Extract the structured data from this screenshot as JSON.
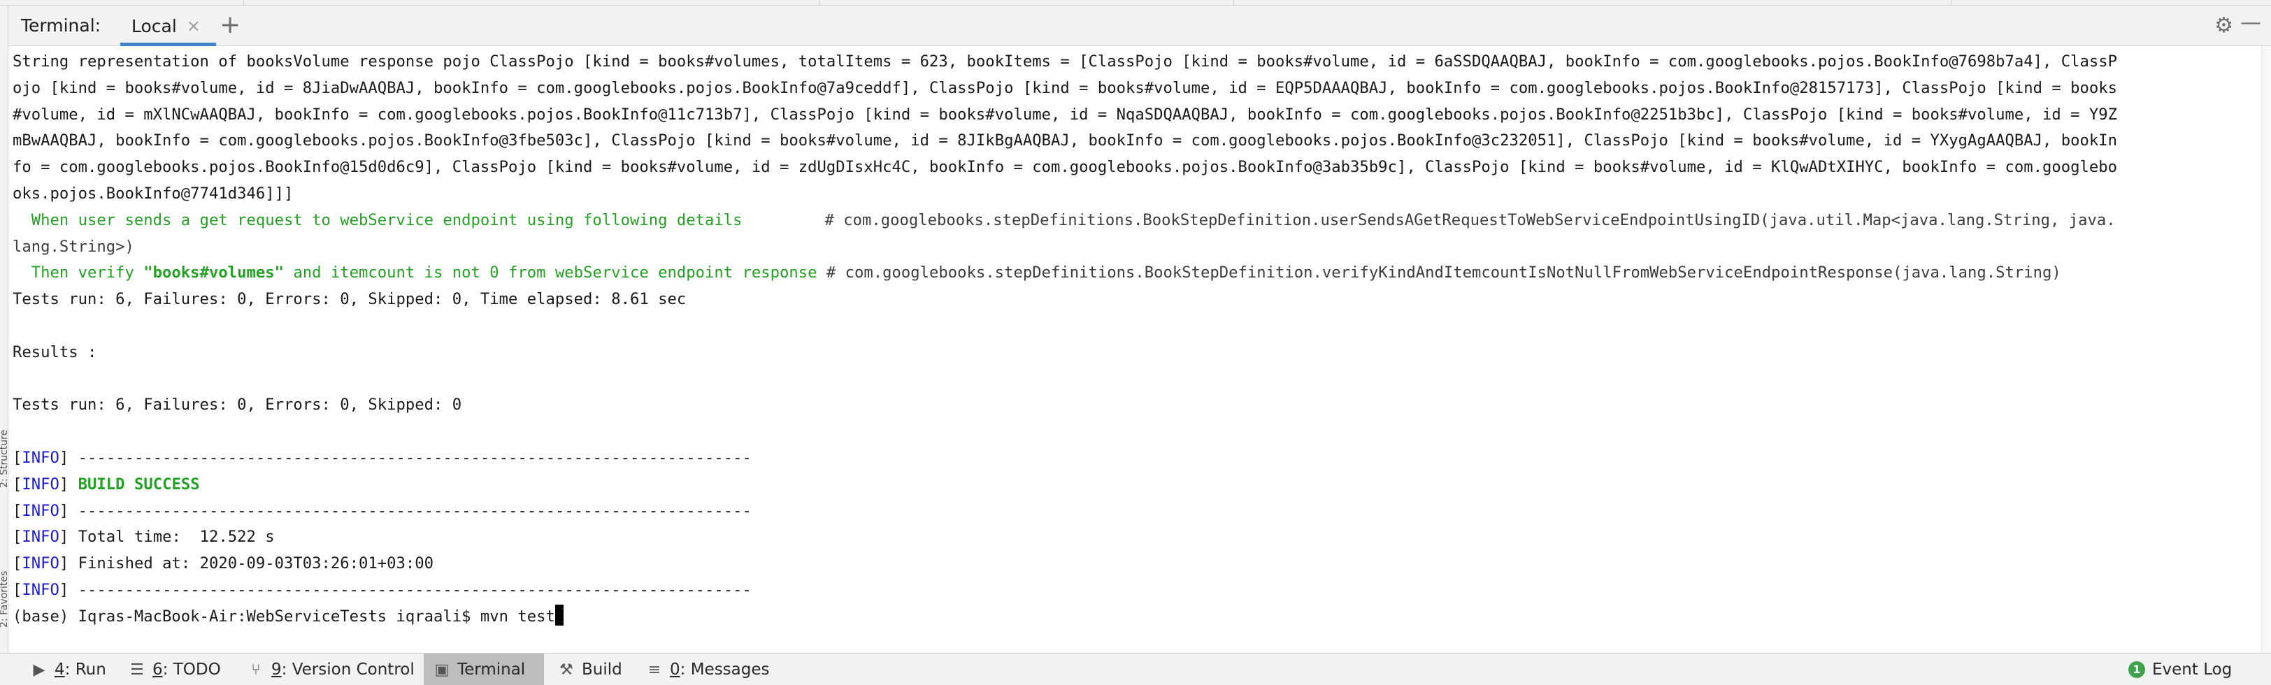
{
  "terminal": {
    "title": "Terminal:",
    "tab_label": "Local",
    "add_tab": "+"
  },
  "left_strip": {
    "labels": [
      "2: Structure",
      "2: Favorites"
    ]
  },
  "output_lines": [
    "String representation of booksVolume response pojo ClassPojo [kind = books#volumes, totalItems = 623, bookItems = [ClassPojo [kind = books#volume, id = 6aSSDQAAQBAJ, bookInfo = com.googlebooks.pojos.BookInfo@7698b7a4], ClassP",
    "ojo [kind = books#volume, id = 8JiaDwAAQBAJ, bookInfo = com.googlebooks.pojos.BookInfo@7a9ceddf], ClassPojo [kind = books#volume, id = EQP5DAAAQBAJ, bookInfo = com.googlebooks.pojos.BookInfo@28157173], ClassPojo [kind = books",
    "#volume, id = mXlNCwAAQBAJ, bookInfo = com.googlebooks.pojos.BookInfo@11c713b7], ClassPojo [kind = books#volume, id = NqaSDQAAQBAJ, bookInfo = com.googlebooks.pojos.BookInfo@2251b3bc], ClassPojo [kind = books#volume, id = Y9Z",
    "mBwAAQBAJ, bookInfo = com.googlebooks.pojos.BookInfo@3fbe503c], ClassPojo [kind = books#volume, id = 8JIkBgAAQBAJ, bookInfo = com.googlebooks.pojos.BookInfo@3c232051], ClassPojo [kind = books#volume, id = YXygAgAAQBAJ, bookIn",
    "fo = com.googlebooks.pojos.BookInfo@15d0d6c9], ClassPojo [kind = books#volume, id = zdUgDIsxHc4C, bookInfo = com.googlebooks.pojos.BookInfo@3ab35b9c], ClassPojo [kind = books#volume, id = KlQwADtXIHYC, bookInfo = com.googlebo",
    "oks.pojos.BookInfo@7741d346]]]"
  ],
  "step_when": {
    "text": "  When user sends a get request to webService endpoint using following details",
    "comment": "# com.googlebooks.stepDefinitions.BookStepDefinition.userSendsAGetRequestToWebServiceEndpointUsingID(java.util.Map<java.lang.String, java.",
    "comment_cont": "lang.String>)"
  },
  "step_then": {
    "prefix": "  Then verify ",
    "arg": "\"books#volumes\"",
    "suffix": " and itemcount is not 0 from webService endpoint response",
    "comment": " # com.googlebooks.stepDefinitions.BookStepDefinition.verifyKindAndItemcountIsNotNullFromWebServiceEndpointResponse(java.lang.String)"
  },
  "summary": {
    "tests_run_1": "Tests run: 6, Failures: 0, Errors: 0, Skipped: 0, Time elapsed: 8.61 sec",
    "results": "Results :",
    "tests_run_2": "Tests run: 6, Failures: 0, Errors: 0, Skipped: 0"
  },
  "maven": {
    "info_tag": "INFO",
    "separator": " ------------------------------------------------------------------------",
    "build_success": " BUILD SUCCESS",
    "total_time": " Total time:  12.522 s",
    "finished_at": " Finished at: 2020-09-03T03:26:01+03:00"
  },
  "prompt": {
    "text": "(base) Iqras-MacBook-Air:WebServiceTests iqraali$ mvn test"
  },
  "bottom_bar": {
    "run": {
      "num": "4",
      "label": ": Run"
    },
    "todo": {
      "num": "6",
      "label": ": TODO"
    },
    "vcs": {
      "num": "9",
      "label": ": Version Control"
    },
    "terminal": "Terminal",
    "build": "Build",
    "messages": {
      "num": "0",
      "label": ": Messages"
    },
    "event_log": "Event Log",
    "event_log_count": "1"
  },
  "colors": {
    "accent_underline": "#4083c9",
    "success_green": "#23a123",
    "info_blue": "#1a1ad6",
    "active_tool_bg": "#bdbdbd"
  },
  "icons": [
    "close-icon",
    "add-tab-icon",
    "gear-icon",
    "minimize-icon",
    "run-icon",
    "todo-icon",
    "version-control-icon",
    "terminal-icon",
    "build-icon",
    "messages-icon",
    "event-log-icon"
  ]
}
